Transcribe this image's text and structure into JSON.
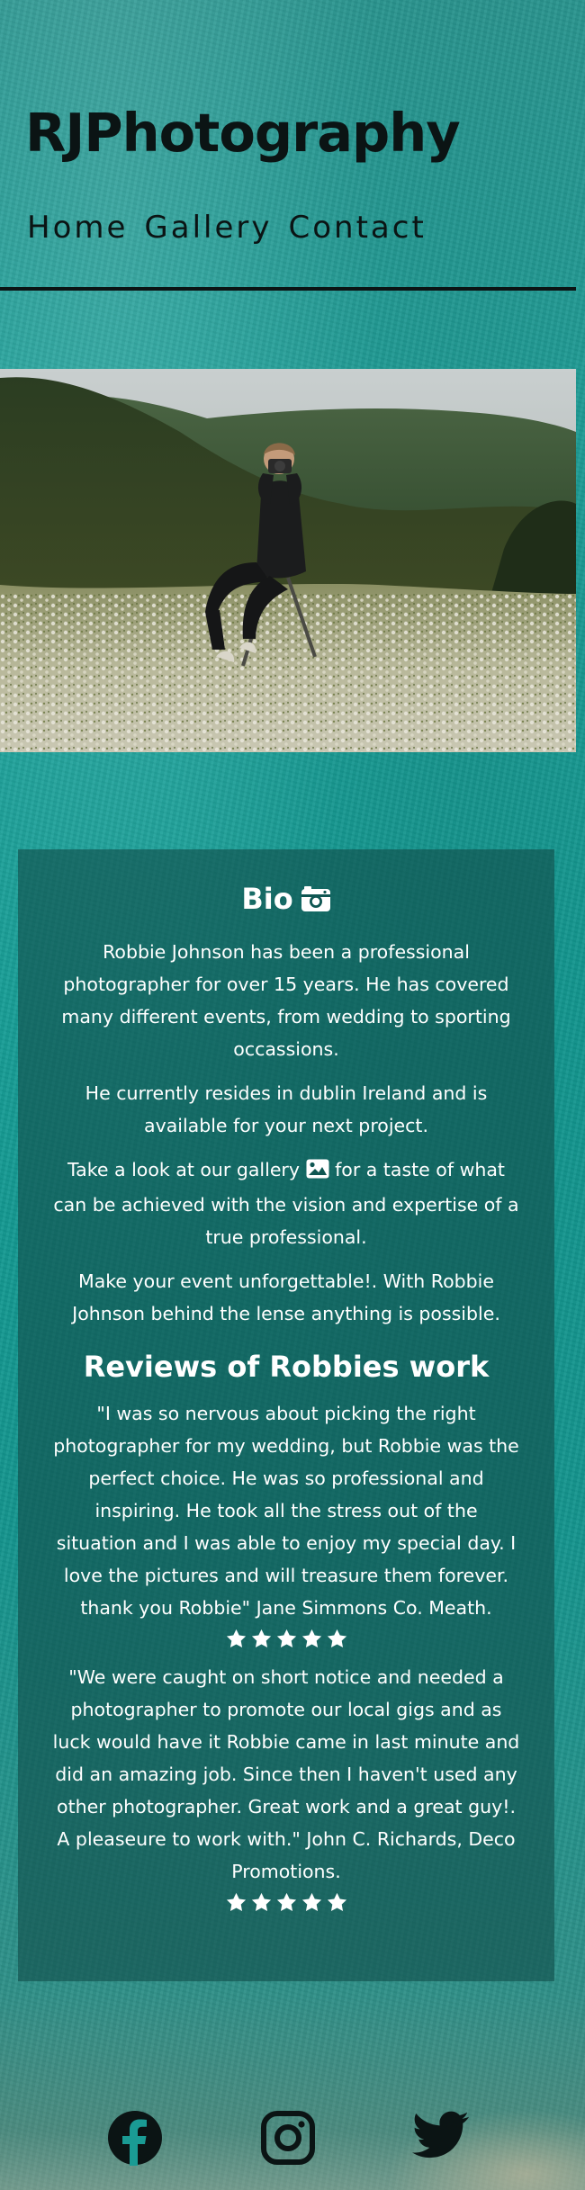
{
  "header": {
    "title": "RJPhotography",
    "nav": [
      "Home",
      "Gallery",
      "Contact"
    ]
  },
  "hero": {
    "alt": "Photographer seated on a stool in a field of white flowers, camera raised, with forested hills behind"
  },
  "bio": {
    "heading": "Bio",
    "heading_icon": "camera-icon",
    "paragraphs": {
      "p1": "Robbie Johnson has been a professional photographer for over 15 years. He has covered many different events, from wedding to sporting occassions.",
      "p2": "He currently resides in dublin Ireland and is available for your next project.",
      "p3_before": "Take a look at our gallery",
      "p3_icon": "image-icon",
      "p3_after": "for a taste of what can be achieved with the vision and expertise of a true professional.",
      "p4": "Make your event unforgettable!. With Robbie Johnson behind the lense anything is possible."
    }
  },
  "reviews": {
    "heading": "Reviews of Robbies work",
    "items": [
      {
        "text": "\"I was so nervous about picking the right photographer for my wedding, but Robbie was the perfect choice. He was so professional and inspiring. He took all the stress out of the situation and I was able to enjoy my special day. I love the pictures and will treasure them forever. thank you Robbie\" Jane Simmons Co. Meath.",
        "rating": 5
      },
      {
        "text": "\"We were caught on short notice and needed a photographer to promote our local gigs and as luck would have it Robbie came in last minute and did an amazing job. Since then I haven't used any other photographer. Great work and a great guy!. A pleaseure to work with.\" John C. Richards, Deco Promotions.",
        "rating": 5
      }
    ]
  },
  "social": [
    "facebook-icon",
    "instagram-icon",
    "twitter-icon"
  ],
  "colors": {
    "background": "#14958e",
    "panel": "#124e4a",
    "text_dark": "#0b1414",
    "text_light": "#ffffff",
    "star": "#ffffff"
  }
}
